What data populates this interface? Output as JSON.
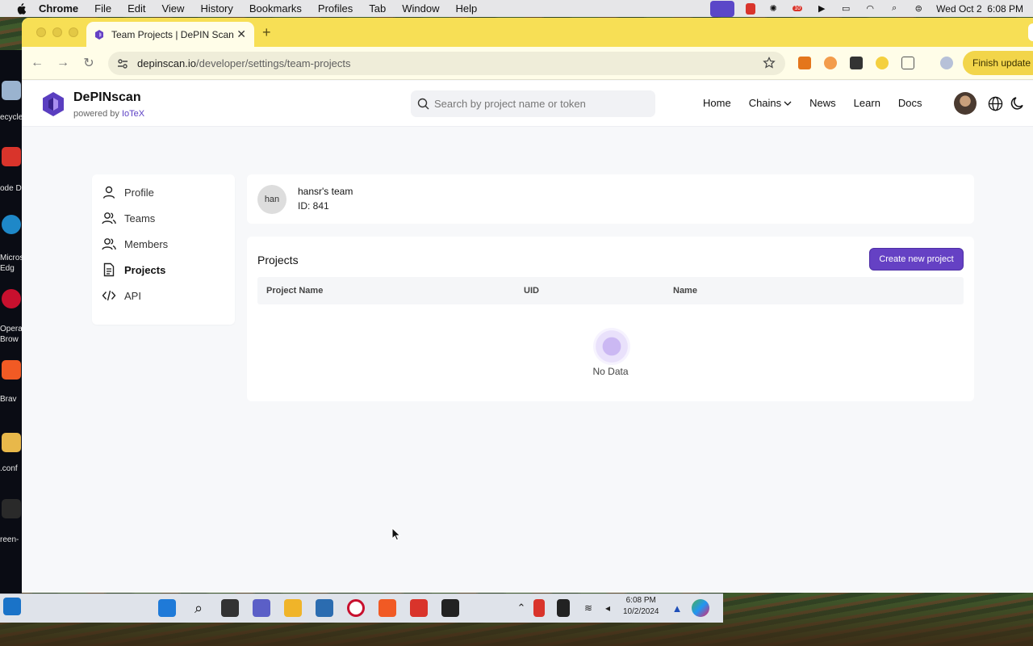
{
  "menubar": {
    "app": "Chrome",
    "items": [
      "File",
      "Edit",
      "View",
      "History",
      "Bookmarks",
      "Profiles",
      "Tab",
      "Window",
      "Help"
    ],
    "clock": "Wed Oct 2  6:08 PM",
    "badge_count": "10"
  },
  "desktop_left": {
    "labels": [
      "ecycle",
      "ode D",
      "Micros",
      "Edg",
      "Opera",
      "Brow",
      "Brav",
      ".conf",
      "reen-"
    ]
  },
  "taskbar": {
    "time": "6:08 PM",
    "date": "10/2/2024"
  },
  "browser": {
    "tab_title": "Team Projects | DePIN Scan",
    "url_host": "depinscan.io",
    "url_path": "/developer/settings/team-projects",
    "finish_update": "Finish update"
  },
  "header": {
    "brand": "DePINscan",
    "powered_by": "powered by",
    "powered_by_brand": "IoTeX",
    "search_placeholder": "Search by project name or token",
    "nav": [
      "Home",
      "Chains",
      "News",
      "Learn",
      "Docs"
    ]
  },
  "sidebar": {
    "items": [
      {
        "label": "Profile",
        "icon": "user-icon"
      },
      {
        "label": "Teams",
        "icon": "users-icon"
      },
      {
        "label": "Members",
        "icon": "users-icon"
      },
      {
        "label": "Projects",
        "icon": "document-icon",
        "active": true
      },
      {
        "label": "API",
        "icon": "code-icon"
      }
    ]
  },
  "team": {
    "avatar_text": "han",
    "name": "hansr's team",
    "id_label": "ID: 841"
  },
  "projects": {
    "title": "Projects",
    "create_button": "Create new project",
    "columns": [
      "Project Name",
      "UID",
      "Name"
    ],
    "rows": [],
    "empty_text": "No Data"
  },
  "colors": {
    "accent": "#6541c4",
    "tabstrip": "#f7df55",
    "page_bg": "#f7f8fa"
  }
}
